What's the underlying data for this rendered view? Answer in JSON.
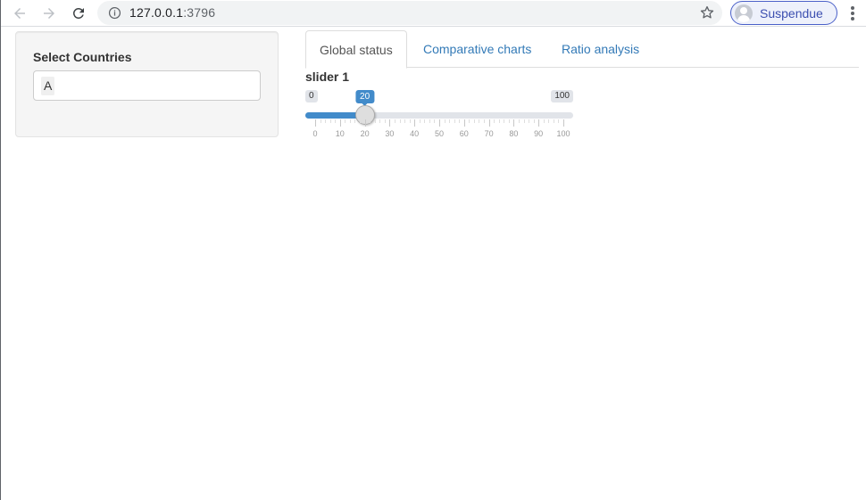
{
  "browser": {
    "url_host": "127.0.0.1",
    "url_port": ":3796",
    "profile_label": "Suspendue",
    "icons": [
      "back-arrow-icon",
      "forward-arrow-icon",
      "reload-icon",
      "info-icon",
      "star-icon",
      "avatar-icon",
      "menu-dots-icon"
    ]
  },
  "sidebar": {
    "label": "Select Countries",
    "selected_item": "A"
  },
  "tabs": [
    {
      "label": "Global status",
      "active": true
    },
    {
      "label": "Comparative charts",
      "active": false
    },
    {
      "label": "Ratio analysis",
      "active": false
    }
  ],
  "slider": {
    "label": "slider 1",
    "min": 0,
    "max": 100,
    "value": 20,
    "min_label": "0",
    "max_label": "100",
    "value_label": "20",
    "tick_labels": [
      "0",
      "10",
      "20",
      "30",
      "40",
      "50",
      "60",
      "70",
      "80",
      "90",
      "100"
    ],
    "accent_color": "#428bca"
  }
}
